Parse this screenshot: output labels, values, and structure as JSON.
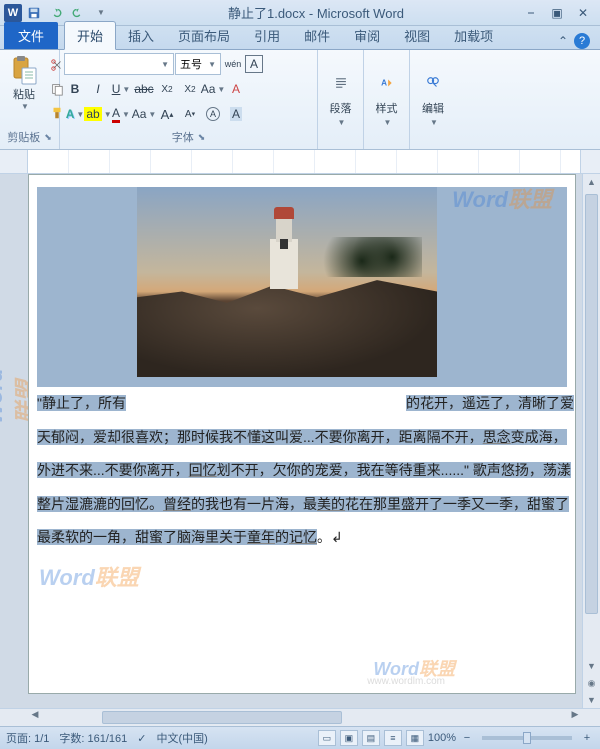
{
  "title": "静止了1.docx - Microsoft Word",
  "tabs": {
    "file": "文件",
    "home": "开始",
    "insert": "插入",
    "layout": "页面布局",
    "references": "引用",
    "mail": "邮件",
    "review": "审阅",
    "view": "视图",
    "addins": "加载项"
  },
  "ribbon": {
    "clipboard": {
      "label": "剪贴板",
      "paste": "粘贴"
    },
    "font": {
      "label": "字体",
      "size_value": "五号",
      "bold": "B",
      "italic": "I",
      "underline": "U",
      "strike": "abc",
      "sub": "X₂",
      "sup": "X²",
      "clear": "A",
      "pinyin": "wén",
      "border": "A"
    },
    "paragraph": {
      "label": "段落"
    },
    "styles": {
      "label": "样式"
    },
    "editing": {
      "label": "编辑"
    }
  },
  "document": {
    "p1_a": "\"静止了，所有",
    "p1_b": "的花开，遥远了，清晰了爱",
    "p2_a": "天郁闷，爱却很喜欢；那时候我不懂这叫爱...不要你离开，距离隔不开，",
    "p2_b": "思念",
    "p2_c": "变成海，",
    "p3_a": "外进不来...不要你离开，",
    "p3_b": "回忆",
    "p3_c": "划不开，欠你的宠爱，我在等待重来......\" 歌声悠扬，荡漾",
    "p4_a": "整片湿漉漉的回忆。",
    "p4_b": "曾经",
    "p4_c": "的我也有一片海，最",
    "p4_d": "美的",
    "p4_e": "花在那里盛开了一季又一季，甜蜜了",
    "p5_a": "最柔软的一角，甜蜜了脑海里关于",
    "p5_b": "童年",
    "p5_c": "的",
    "p5_d": "记忆",
    "p5_e": "。"
  },
  "status": {
    "page": "页面: 1/1",
    "words": "字数: 161/161",
    "lang": "中文(中国)",
    "zoom": "100%"
  },
  "watermark": {
    "word": "Word",
    "lianmeng": "联盟",
    "url": "www.wordlm.com"
  }
}
